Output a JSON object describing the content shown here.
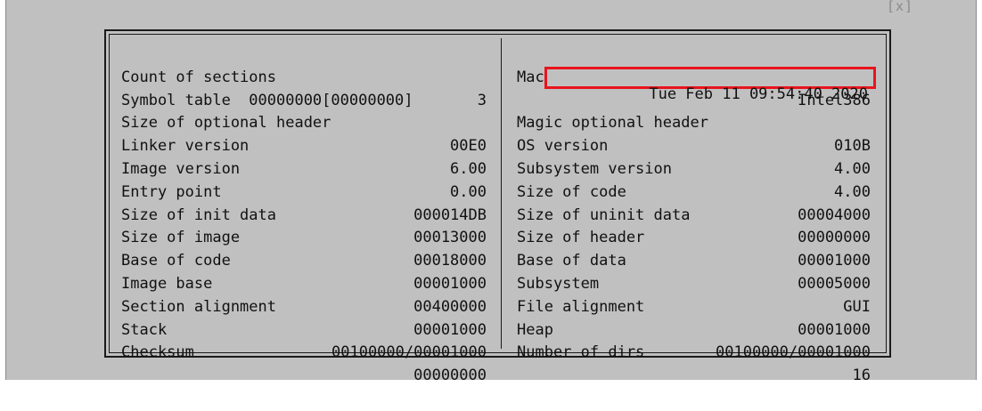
{
  "window": {
    "close_label": "[x]"
  },
  "left_rows": [
    {
      "label": "Count of sections",
      "value": "3"
    },
    {
      "text": "Symbol table  00000000[00000000]"
    },
    {
      "label": "Size of optional header",
      "value": "00E0"
    },
    {
      "label": "Linker version",
      "value": "6.00"
    },
    {
      "label": "Image version",
      "value": "0.00"
    },
    {
      "label": "Entry point",
      "value": "000014DB"
    },
    {
      "label": "Size of init data",
      "value": "00013000"
    },
    {
      "label": "Size of image",
      "value": "00018000"
    },
    {
      "label": "Base of code",
      "value": "00001000"
    },
    {
      "label": "Image base",
      "value": "00400000"
    },
    {
      "label": "Section alignment",
      "value": "00001000"
    },
    {
      "label": "Stack",
      "value": "00100000/00001000"
    },
    {
      "label": "Checksum",
      "value": "00000000"
    }
  ],
  "right_rows": [
    {
      "label": "Machine",
      "value": "Intel386"
    },
    {
      "label": "",
      "value": "Tue Feb 11 09:54:40 2020",
      "highlighted": true
    },
    {
      "label": "Magic optional header",
      "value": "010B"
    },
    {
      "label": "OS version",
      "value": "4.00"
    },
    {
      "label": "Subsystem version",
      "value": "4.00"
    },
    {
      "label": "Size of code",
      "value": "00004000"
    },
    {
      "label": "Size of uninit data",
      "value": "00000000"
    },
    {
      "label": "Size of header",
      "value": "00001000"
    },
    {
      "label": "Base of data",
      "value": "00005000"
    },
    {
      "label": "Subsystem",
      "value": "GUI"
    },
    {
      "label": "File alignment",
      "value": "00001000"
    },
    {
      "label": "Heap",
      "value": "00100000/00001000"
    },
    {
      "label": "Number of dirs",
      "value": "16"
    }
  ],
  "colors": {
    "background": "#c0c0c0",
    "text": "#111111",
    "highlight_border": "#e8141c"
  }
}
